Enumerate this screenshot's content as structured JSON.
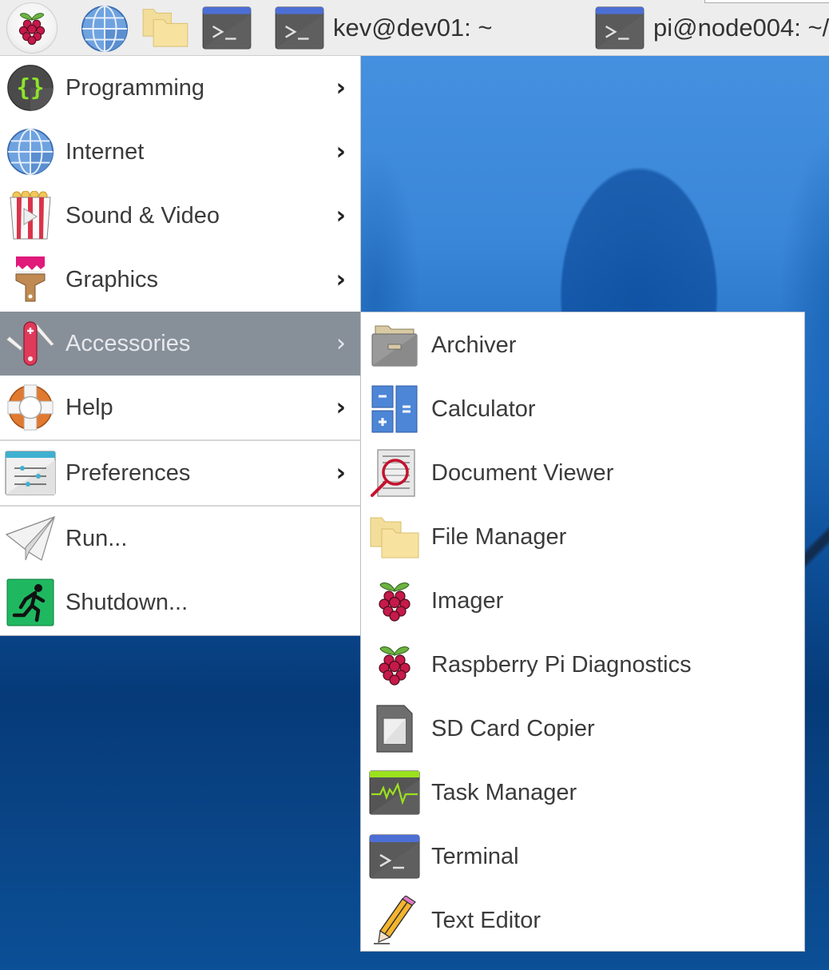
{
  "taskbar": {
    "launchers": [
      {
        "name": "menu",
        "icon": "raspberry-icon"
      },
      {
        "name": "web-browser",
        "icon": "globe-icon"
      },
      {
        "name": "file-manager",
        "icon": "folder-icon"
      },
      {
        "name": "terminal",
        "icon": "terminal-icon"
      }
    ],
    "tasks": [
      {
        "label": "kev@dev01: ~",
        "icon": "terminal-icon"
      },
      {
        "label": "pi@node004: ~/",
        "icon": "terminal-icon"
      }
    ]
  },
  "main_menu": {
    "items": [
      {
        "label": "Programming",
        "icon": "code-braces-icon",
        "submenu": true
      },
      {
        "label": "Internet",
        "icon": "globe-icon",
        "submenu": true
      },
      {
        "label": "Sound & Video",
        "icon": "popcorn-play-icon",
        "submenu": true
      },
      {
        "label": "Graphics",
        "icon": "paintbrush-icon",
        "submenu": true
      },
      {
        "label": "Accessories",
        "icon": "swiss-knife-icon",
        "submenu": true,
        "active": true
      },
      {
        "label": "Help",
        "icon": "lifebuoy-icon",
        "submenu": true
      },
      {
        "label": "Preferences",
        "icon": "sliders-icon",
        "submenu": true
      },
      {
        "label": "Run...",
        "icon": "paper-plane-icon",
        "submenu": false
      },
      {
        "label": "Shutdown...",
        "icon": "exit-running-man-icon",
        "submenu": false
      }
    ],
    "arrow": "›",
    "active_color": "#878f99"
  },
  "accessories_submenu": {
    "items": [
      {
        "label": "Archiver",
        "icon": "archive-drawer-icon"
      },
      {
        "label": "Calculator",
        "icon": "calculator-icon"
      },
      {
        "label": "Document Viewer",
        "icon": "document-magnifier-icon"
      },
      {
        "label": "File Manager",
        "icon": "folder-icon"
      },
      {
        "label": "Imager",
        "icon": "raspberry-icon"
      },
      {
        "label": "Raspberry Pi Diagnostics",
        "icon": "raspberry-icon"
      },
      {
        "label": "SD Card Copier",
        "icon": "sd-card-icon"
      },
      {
        "label": "Task Manager",
        "icon": "activity-monitor-icon"
      },
      {
        "label": "Terminal",
        "icon": "terminal-icon"
      },
      {
        "label": "Text Editor",
        "icon": "pencil-icon"
      }
    ]
  }
}
